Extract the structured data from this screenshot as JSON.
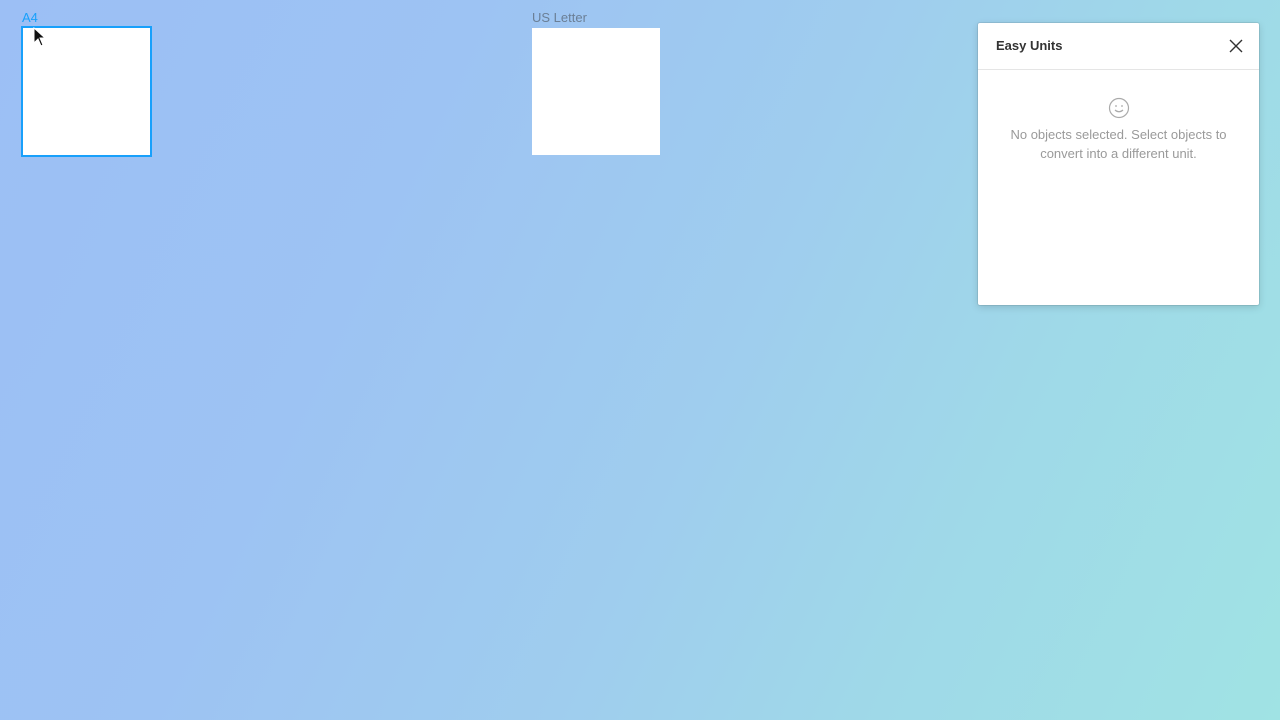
{
  "canvas": {
    "frames": [
      {
        "label": "A4",
        "selected": true
      },
      {
        "label": "US Letter",
        "selected": false
      }
    ]
  },
  "plugin": {
    "title": "Easy Units",
    "close_icon": "close-icon",
    "empty_icon": "smile-icon",
    "empty_message": "No objects selected. Select objects to convert into a different unit."
  },
  "colors": {
    "selection": "#18a0fb",
    "label_normal": "#6b7f96",
    "empty_text": "#9a9a9a"
  }
}
